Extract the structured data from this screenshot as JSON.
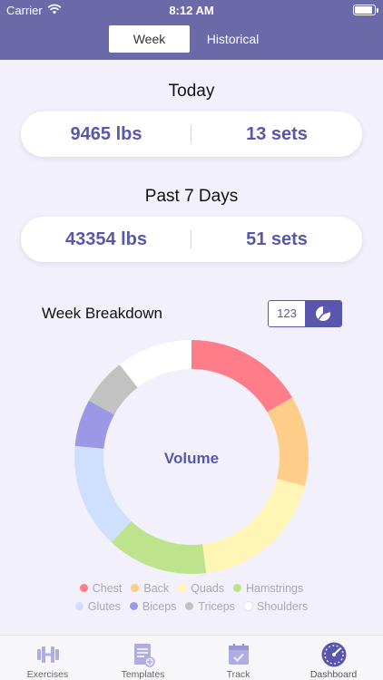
{
  "status_bar": {
    "carrier": "Carrier",
    "time": "8:12 AM"
  },
  "segmented": {
    "week": "Week",
    "historical": "Historical",
    "selected": "Week"
  },
  "today": {
    "title": "Today",
    "weight": "9465 lbs",
    "sets": "13 sets"
  },
  "past7": {
    "title": "Past 7 Days",
    "weight": "43354 lbs",
    "sets": "51 sets"
  },
  "breakdown": {
    "title": "Week Breakdown",
    "toggle_numeric": "123",
    "center_label": "Volume"
  },
  "chart_data": {
    "type": "pie",
    "categories": [
      "Chest",
      "Back",
      "Quads",
      "Hamstrings",
      "Glutes",
      "Biceps",
      "Triceps",
      "Shoulders"
    ],
    "values": [
      16.5,
      12.5,
      19,
      14,
      14.5,
      6.5,
      6.5,
      10.5
    ],
    "colors": [
      "#ff7d89",
      "#ffcd8a",
      "#fff6b6",
      "#bde48c",
      "#cfdfff",
      "#9c98e6",
      "#c2c2c2",
      "#ffffff"
    ],
    "legend_placement": "bottom"
  },
  "tabbar": {
    "items": [
      {
        "label": "Exercises",
        "icon": "dumbbell-icon"
      },
      {
        "label": "Templates",
        "icon": "template-add-icon"
      },
      {
        "label": "Track",
        "icon": "calendar-check-icon"
      },
      {
        "label": "Dashboard",
        "icon": "speedometer-icon"
      }
    ],
    "active": "Dashboard"
  },
  "colors": {
    "header": "#6b69a8",
    "accent": "#5a56ad",
    "background": "#f1f0fb"
  }
}
